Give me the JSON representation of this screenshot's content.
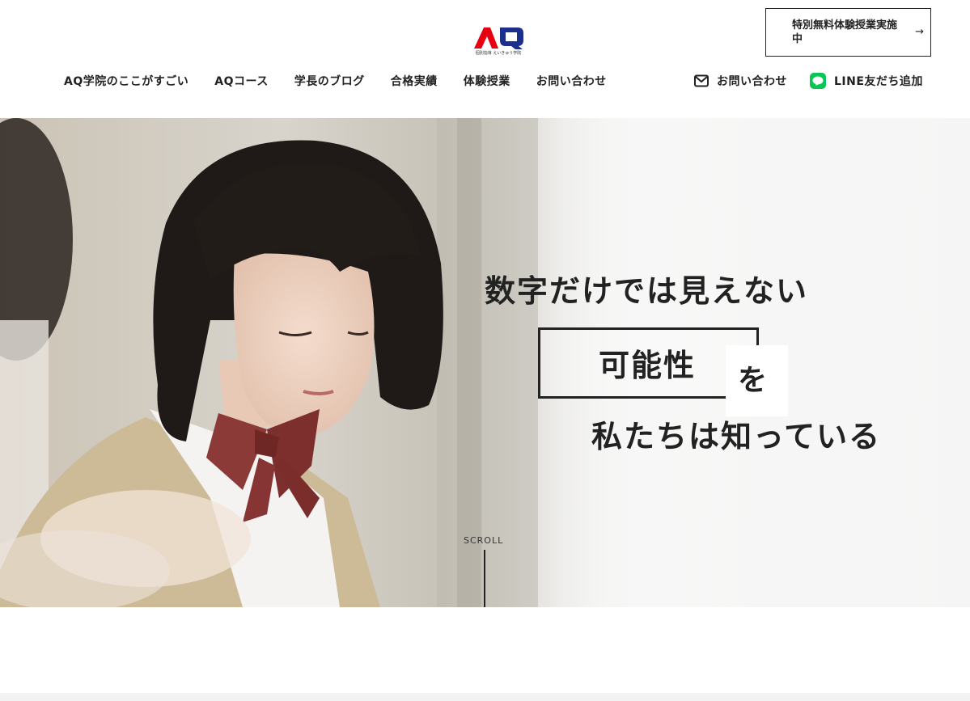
{
  "header": {
    "logo": {
      "mark": "AQ",
      "subtitle": "個別指導 えいきゅう学院",
      "colors": {
        "a": "#e60012",
        "q": "#1d2f8c"
      }
    },
    "trial_button": {
      "label": "特別無料体験授業実施中",
      "arrow": "→"
    },
    "nav": [
      {
        "label": "AQ学院のここがすごい"
      },
      {
        "label": "AQコース"
      },
      {
        "label": "学長のブログ"
      },
      {
        "label": "合格実績"
      },
      {
        "label": "体験授業"
      },
      {
        "label": "お問い合わせ"
      }
    ],
    "contact": {
      "label": "お問い合わせ",
      "icon": "mail-icon"
    },
    "line": {
      "label": "LINE友だち追加",
      "icon": "line-icon",
      "color": "#06c755"
    }
  },
  "hero": {
    "copy_line1": "数字だけでは見えない",
    "copy_highlight": "可能性",
    "copy_particle": "を",
    "copy_line3": "私たちは知っている",
    "scroll_label": "SCROLL"
  }
}
